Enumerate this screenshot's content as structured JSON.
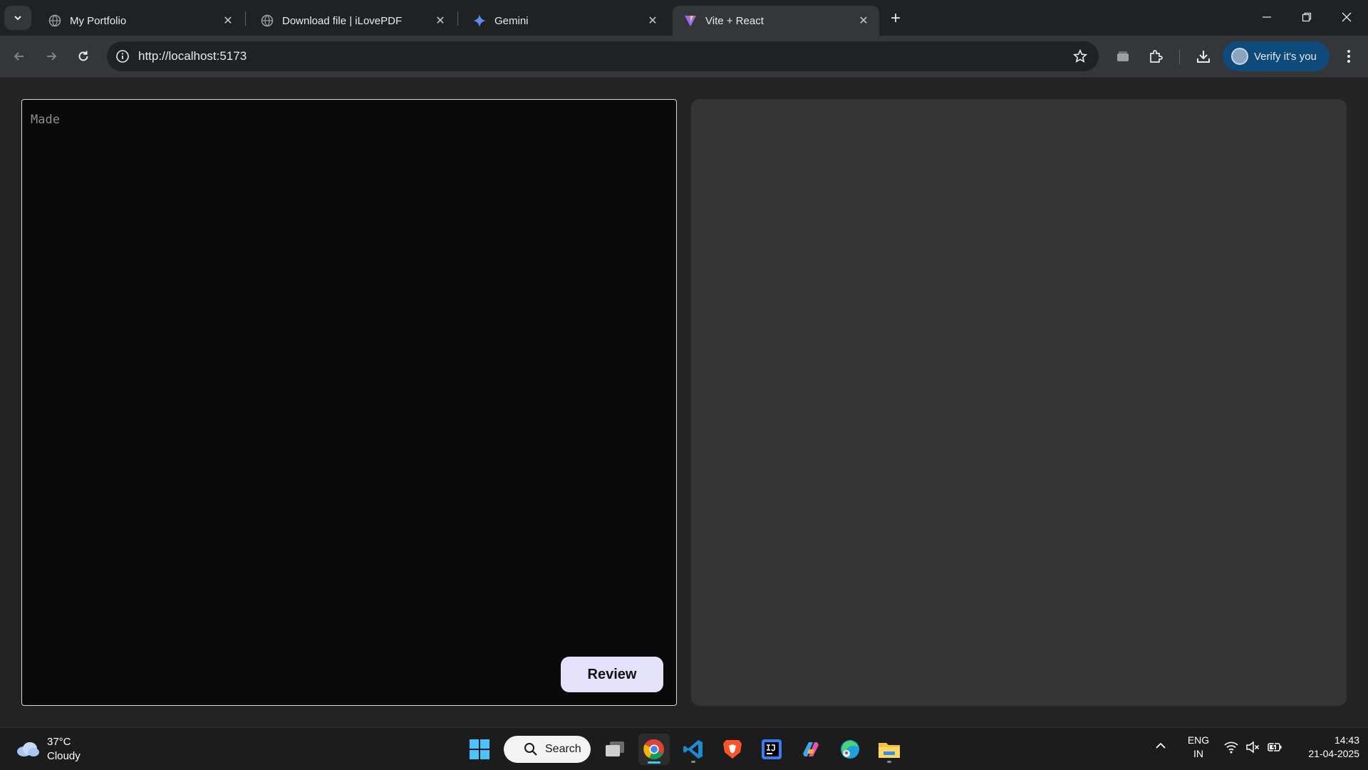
{
  "browser": {
    "tabs": [
      {
        "title": "My Portfolio",
        "icon": "globe-icon",
        "active": false
      },
      {
        "title": "Download file | iLovePDF",
        "icon": "globe-icon",
        "active": false
      },
      {
        "title": "Gemini",
        "icon": "gemini-sparkle-icon",
        "active": false
      },
      {
        "title": "Vite + React",
        "icon": "vite-icon",
        "active": true
      }
    ],
    "new_tab_symbol": "+",
    "url": "http://localhost:5173",
    "verify_label": "Verify it's you"
  },
  "app": {
    "editor_text": "Made",
    "review_label": "Review"
  },
  "taskbar": {
    "weather_temp": "37°C",
    "weather_desc": "Cloudy",
    "search_label": "Search",
    "lang_line1": "ENG",
    "lang_line2": "IN",
    "time": "14:43",
    "date": "21-04-2025"
  },
  "colors": {
    "page_bg": "#242424",
    "editor_bg": "#0a0a0a",
    "output_bg": "#353535",
    "review_button_bg": "#e4e2fb",
    "verify_bg": "#0e4a7a"
  }
}
